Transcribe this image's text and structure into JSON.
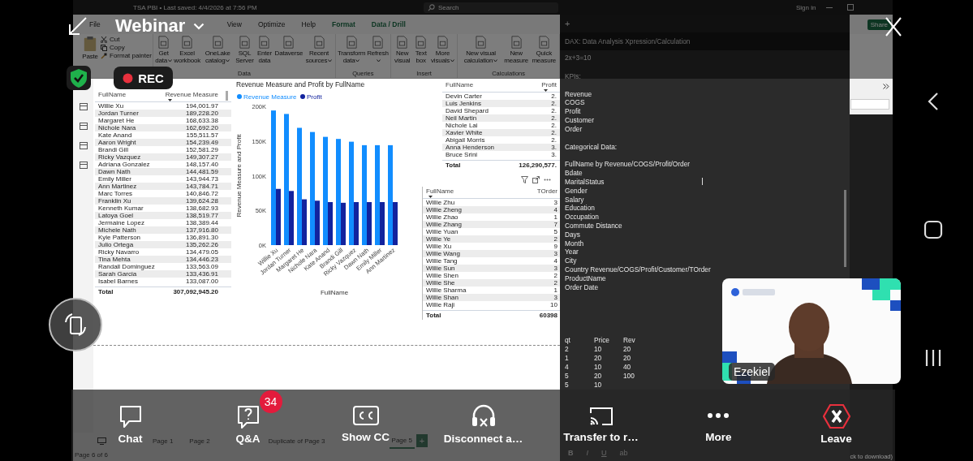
{
  "share_status": {
    "title": "Webinar",
    "recording": "REC"
  },
  "pbi": {
    "title_bar": {
      "file": "TSA PBI • Last saved: 4/4/2026 at 7:56 PM",
      "search": {
        "placeholder": "Search"
      },
      "sign_in": "Sign in",
      "share": "Share"
    },
    "menu": [
      {
        "label": "File",
        "contextual": false
      },
      {
        "label": "View",
        "contextual": false
      },
      {
        "label": "Optimize",
        "contextual": false
      },
      {
        "label": "Help",
        "contextual": false
      },
      {
        "label": "Format",
        "contextual": true
      },
      {
        "label": "Data / Drill",
        "contextual": true
      }
    ],
    "clipboard": {
      "paste": "Paste",
      "items": [
        {
          "label": "Cut",
          "kind": "scissors"
        },
        {
          "label": "Copy",
          "kind": "copy"
        },
        {
          "label": "Format painter",
          "kind": "brush"
        }
      ]
    },
    "ribbon_groups": [
      {
        "label": "Data",
        "buttons": [
          {
            "label": "Get data",
            "dropdown": true
          },
          {
            "label": "Excel workbook",
            "dropdown": false
          },
          {
            "label": "OneLake catalog",
            "dropdown": true
          },
          {
            "label": "SQL Server",
            "dropdown": false
          },
          {
            "label": "Enter data",
            "dropdown": false
          },
          {
            "label": "Dataverse",
            "dropdown": false
          },
          {
            "label": "Recent sources",
            "dropdown": true
          }
        ]
      },
      {
        "label": "Queries",
        "buttons": [
          {
            "label": "Transform data",
            "dropdown": true
          },
          {
            "label": "Refresh",
            "dropdown": true
          }
        ]
      },
      {
        "label": "Insert",
        "buttons": [
          {
            "label": "New visual",
            "dropdown": false
          },
          {
            "label": "Text box",
            "dropdown": false
          },
          {
            "label": "More visuals",
            "dropdown": true
          }
        ]
      },
      {
        "label": "Calculations",
        "buttons": [
          {
            "label": "New visual calculation",
            "dropdown": true
          },
          {
            "label": "New measure",
            "dropdown": false
          },
          {
            "label": "Quick measure",
            "dropdown": false
          }
        ]
      }
    ],
    "revenue_table": {
      "columns": [
        "FullName",
        "Revenue Measure"
      ],
      "rows": [
        [
          "Willie Xu",
          "194,001.97"
        ],
        [
          "Jordan Turner",
          "189,228.20"
        ],
        [
          "Margaret He",
          "168,633.38"
        ],
        [
          "Nichole Nara",
          "162,692.20"
        ],
        [
          "Kate Anand",
          "155,511.57"
        ],
        [
          "Aaron Wright",
          "154,239.49"
        ],
        [
          "Brandi Gill",
          "152,581.29"
        ],
        [
          "Ricky Vazquez",
          "149,307.27"
        ],
        [
          "Adriana Gonzalez",
          "148,157.40"
        ],
        [
          "Dawn Nath",
          "144,481.59"
        ],
        [
          "Emily Miller",
          "143,944.73"
        ],
        [
          "Ann Martinez",
          "143,784.71"
        ],
        [
          "Marc Torres",
          "140,846.72"
        ],
        [
          "Franklin Xu",
          "139,624.28"
        ],
        [
          "Kenneth Kumar",
          "138,682.93"
        ],
        [
          "Latoya Goel",
          "138,519.77"
        ],
        [
          "Jermaine Lopez",
          "138,389.44"
        ],
        [
          "Michele Nath",
          "137,916.80"
        ],
        [
          "Kyle Patterson",
          "136,891.30"
        ],
        [
          "Julio Ortega",
          "135,262.26"
        ],
        [
          "Ricky Navarro",
          "134,479.05"
        ],
        [
          "Tina Mehta",
          "134,446.23"
        ],
        [
          "Randall Dominguez",
          "133,563.09"
        ],
        [
          "Sarah Garcia",
          "133,436.91"
        ],
        [
          "Isabel Barnes",
          "133,087.00"
        ]
      ],
      "total": [
        "Total",
        "307,092,945.20"
      ]
    },
    "chart": {
      "chart_data": {
        "type": "bar",
        "title": "Revenue Measure and Profit by FullName",
        "xlabel": "FullName",
        "ylabel": "Revenue Measure and Profit",
        "categories": [
          "Willie Xu",
          "Jordan Turner",
          "Margaret He",
          "Nichole Nara",
          "Kate Anand",
          "Brandi Gill",
          "Ricky Vazquez",
          "Dawn Nath",
          "Emily Miller",
          "Ann Martinez"
        ],
        "series": [
          {
            "name": "Revenue Measure",
            "color": "#118dff",
            "values": [
              194000,
              189000,
              169000,
              163000,
              156000,
              153000,
              149000,
              144000,
              144000,
              144000
            ]
          },
          {
            "name": "Profit",
            "color": "#12239e",
            "values": [
              81000,
              78000,
              66000,
              64000,
              62000,
              61000,
              62000,
              62000,
              62000,
              62000
            ]
          }
        ],
        "legend": "top",
        "ylim": [
          0,
          200000
        ],
        "yticks": [
          {
            "value": 0,
            "label": "0K"
          },
          {
            "value": 50000,
            "label": "50K"
          },
          {
            "value": 100000,
            "label": "100K"
          },
          {
            "value": 150000,
            "label": "150K"
          },
          {
            "value": 200000,
            "label": "200K"
          }
        ]
      }
    },
    "profit_table": {
      "columns": [
        "FullName",
        "Profit"
      ],
      "rows": [
        [
          "Devin Carter",
          "2."
        ],
        [
          "Luis Jenkins",
          "2."
        ],
        [
          "David Shepard",
          "2."
        ],
        [
          "Neil Martin",
          "2."
        ],
        [
          "Nichole Lai",
          "2."
        ],
        [
          "Xavier White",
          "2."
        ],
        [
          "Abigail Morris",
          "2."
        ],
        [
          "Anna Henderson",
          "3."
        ],
        [
          "Bruce Srini",
          "3."
        ]
      ],
      "total": [
        "Total",
        "126,290,577."
      ]
    },
    "order_table": {
      "columns": [
        "FullName",
        "TOrder"
      ],
      "rows": [
        [
          "Willie Zhu",
          "3"
        ],
        [
          "Willie Zheng",
          "4"
        ],
        [
          "Willie Zhao",
          "1"
        ],
        [
          "Willie Zhang",
          "7"
        ],
        [
          "Willie Yuan",
          "5"
        ],
        [
          "Willie Ye",
          "2"
        ],
        [
          "Willie Xu",
          "9"
        ],
        [
          "Willie Wang",
          "3"
        ],
        [
          "Willie Tang",
          "4"
        ],
        [
          "Willie Sun",
          "3"
        ],
        [
          "Willie Shen",
          "2"
        ],
        [
          "Willie She",
          "2"
        ],
        [
          "Willie Sharma",
          "1"
        ],
        [
          "Willie Shan",
          "3"
        ],
        [
          "Willie Raji",
          "10"
        ]
      ],
      "total": [
        "Total",
        "60398"
      ]
    },
    "page_tabs": [
      {
        "label": "Page 1",
        "selected": false
      },
      {
        "label": "Page 2",
        "selected": false
      },
      {
        "label": "Duplicate of Page 3",
        "selected": false
      },
      {
        "label": "Page 5",
        "selected": true
      }
    ],
    "add_page": "+",
    "page_status": "Page 6 of 6",
    "side_hint": "ck to download)"
  },
  "notepad": {
    "title": "DAX: Data Analysis Xpression/Calculation",
    "new_tab": "+",
    "blocks": [
      [
        "2x+3=10"
      ],
      [
        "KPIs:"
      ],
      [
        "Revenue",
        "COGS",
        "Profit",
        "Customer",
        "Order"
      ],
      [
        "Categorical Data:"
      ],
      [
        "FullName by Revenue/COGS/Profit/Order",
        "Bdate",
        "MaritalStatus",
        "Gender",
        "Salary",
        "Education",
        "Occupation",
        "Commute Distance",
        "Days",
        "Month",
        "Year",
        "City",
        "Country Revenue/COGS/Profit/Customer/TOrder",
        "ProductName",
        "Order Date"
      ]
    ],
    "calc_table": {
      "columns": [
        "qt",
        "Price",
        "Rev"
      ],
      "rows": [
        [
          "2",
          "10",
          "20"
        ],
        [
          "1",
          "20",
          "20"
        ],
        [
          "4",
          "10",
          "40"
        ],
        [
          "5",
          "20",
          "100"
        ],
        [
          "5",
          "10"
        ]
      ]
    },
    "format_toolbar": [
      "B",
      "I",
      "U",
      "ab"
    ]
  },
  "video": {
    "name": "Ezekiel"
  },
  "controls": [
    {
      "label": "Chat",
      "kind": "chat"
    },
    {
      "label": "Q&A",
      "kind": "qa",
      "badge": "34"
    },
    {
      "label": "Show CC",
      "kind": "cc"
    },
    {
      "label": "Disconnect a…",
      "kind": "headset"
    },
    {
      "label": "Transfer to r…",
      "kind": "cast"
    },
    {
      "label": "More",
      "kind": "more"
    },
    {
      "label": "Leave",
      "kind": "leave"
    }
  ]
}
